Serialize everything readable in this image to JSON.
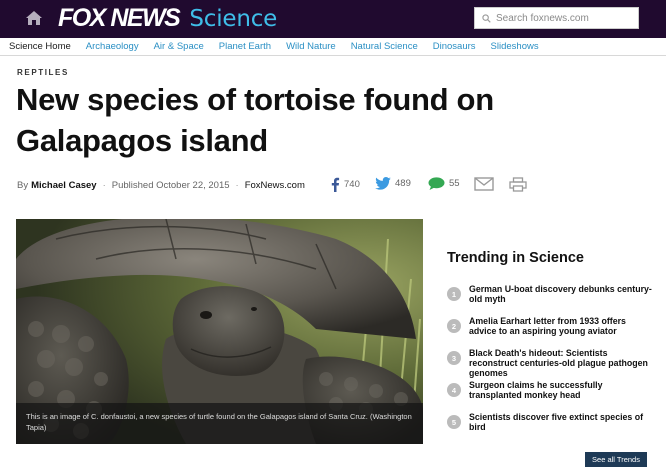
{
  "header": {
    "brand": "FOX NEWS",
    "section": "Science",
    "search_placeholder": "Search foxnews.com",
    "brand_color": "#200a2f",
    "accent_color": "#3fbde8"
  },
  "subnav": {
    "items": [
      {
        "label": "Science Home"
      },
      {
        "label": "Archaeology"
      },
      {
        "label": "Air & Space"
      },
      {
        "label": "Planet Earth"
      },
      {
        "label": "Wild Nature"
      },
      {
        "label": "Natural Science"
      },
      {
        "label": "Dinosaurs"
      },
      {
        "label": "Slideshows"
      }
    ]
  },
  "article": {
    "kicker": "REPTILES",
    "headline": "New species of tortoise found on Galapagos island",
    "byline_prefix": "By",
    "author": "Michael Casey",
    "published": "Published October 22, 2015",
    "source": "FoxNews.com",
    "caption": "This is an image of C. donfaustoi, a new species of turtle found on the Galapagos island of Santa Cruz. (Washington Tapia)"
  },
  "social": {
    "facebook_count": "740",
    "twitter_count": "489",
    "comments_count": "55",
    "icons": [
      "facebook-icon",
      "twitter-icon",
      "comment-icon",
      "email-icon",
      "print-icon"
    ]
  },
  "trending": {
    "title": "Trending in Science",
    "items": [
      {
        "num": "1",
        "text": "German U-boat discovery debunks century-old myth"
      },
      {
        "num": "2",
        "text": "Amelia Earhart letter from 1933 offers advice to an aspiring young aviator"
      },
      {
        "num": "3",
        "text": "Black Death's hideout: Scientists reconstruct centuries-old plague pathogen genomes"
      },
      {
        "num": "4",
        "text": "Surgeon claims he successfully transplanted monkey head"
      },
      {
        "num": "5",
        "text": "Scientists discover five extinct species of bird"
      }
    ],
    "see_all": "See all Trends"
  }
}
